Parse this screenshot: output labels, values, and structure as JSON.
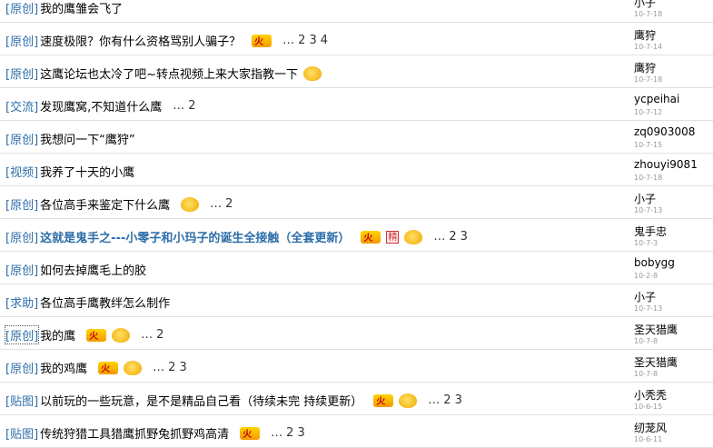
{
  "threads": [
    {
      "category": "[原创]",
      "title": "我的鹰雏会飞了",
      "icons": [
        "image"
      ],
      "pages": [],
      "author": "小子",
      "date": "10-7-18"
    },
    {
      "category": "[原创]",
      "title": "速度极限？你有什么资格骂别人骗子？",
      "icons": [
        "image",
        "hot"
      ],
      "pages": [
        "…",
        "2",
        "3",
        "4"
      ],
      "author": "鹰狩",
      "date": "10-7-14"
    },
    {
      "category": "[原创]",
      "title": "这鹰论坛也太冷了吧~转点视频上来大家指教一下",
      "icons": [
        "smile"
      ],
      "pages": [],
      "author": "鹰狩",
      "date": "10-7-18"
    },
    {
      "category": "[交流]",
      "title": "发现鹰窝,不知道什么鹰",
      "icons": [],
      "pages": [
        "…",
        "2"
      ],
      "author": "ycpeihai",
      "date": "10-7-12"
    },
    {
      "category": "[原创]",
      "title": "我想问一下“鹰狩”",
      "icons": [],
      "pages": [],
      "author": "zq0903008",
      "date": "10-7-15"
    },
    {
      "category": "[视频]",
      "title": "我养了十天的小鹰",
      "icons": [],
      "pages": [],
      "author": "zhouyi9081",
      "date": "10-7-18"
    },
    {
      "category": "[原创]",
      "title": "各位高手来鉴定下什么鹰",
      "icons": [
        "image",
        "smile"
      ],
      "pages": [
        "…",
        "2"
      ],
      "author": "小子",
      "date": "10-7-13"
    },
    {
      "category": "[原创]",
      "title": "这就是鬼手之---小零子和小玛子的诞生全接触（全套更新）",
      "icons": [
        "image",
        "hot",
        "lock",
        "smile"
      ],
      "pages": [
        "…",
        "2",
        "3"
      ],
      "author": "鬼手忠",
      "date": "10-7-3",
      "bold": true
    },
    {
      "category": "[原创]",
      "title": "如何去掉鹰毛上的胶",
      "icons": [],
      "pages": [],
      "author": "bobygg",
      "date": "10-2-8"
    },
    {
      "category": "[求助]",
      "title": "各位高手鹰教绊怎么制作",
      "icons": [],
      "pages": [],
      "author": "小子",
      "date": "10-7-13"
    },
    {
      "category": "[原创]",
      "title": "我的鹰",
      "icons": [
        "image",
        "hot",
        "smile"
      ],
      "pages": [
        "…",
        "2"
      ],
      "author": "圣天猎鹰",
      "date": "10-7-8",
      "dotted": true
    },
    {
      "category": "[原创]",
      "title": "我的鸡鹰",
      "icons": [
        "image",
        "hot",
        "smile"
      ],
      "pages": [
        "…",
        "2",
        "3"
      ],
      "author": "圣天猎鹰",
      "date": "10-7-8"
    },
    {
      "category": "[贴图]",
      "title": "以前玩的一些玩意，是不是精品自己看（待续未完 持续更新）",
      "icons": [
        "image",
        "hot",
        "smile"
      ],
      "pages": [
        "…",
        "2",
        "3"
      ],
      "author": "小秃秃",
      "date": "10-6-15"
    },
    {
      "category": "[贴图]",
      "title": "传统狩猎工具猎鹰抓野兔抓野鸡高清",
      "icons": [
        "image",
        "hot"
      ],
      "pages": [
        "…",
        "2",
        "3"
      ],
      "author": "纫茏风",
      "date": "10-6-11"
    }
  ],
  "icon_labels": {
    "hot": "火",
    "lock": "精"
  }
}
